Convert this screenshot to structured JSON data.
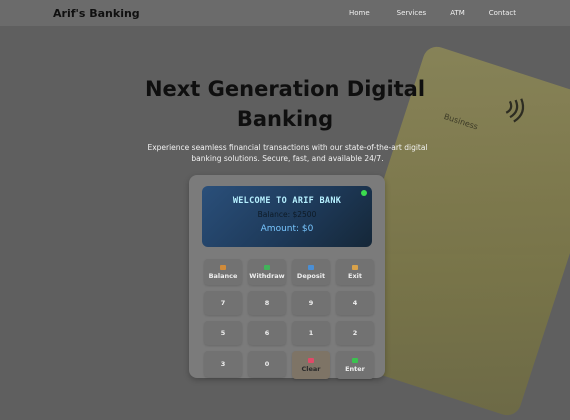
{
  "nav": {
    "brand": "Arif's Banking",
    "links": [
      "Home",
      "Services",
      "ATM",
      "Contact"
    ]
  },
  "hero": {
    "title_line1": "Next Generation Digital",
    "title_line2": "Banking",
    "subtitle_line1": "Experience seamless financial transactions with our state-of-the-art digital",
    "subtitle_line2": "banking solutions. Secure, fast, and available 24/7."
  },
  "bg_card": {
    "label": "Business"
  },
  "atm": {
    "screen": {
      "welcome": "WELCOME TO ARIF BANK",
      "balance": "Balance: $2500",
      "amount": "Amount: $0"
    },
    "actions": [
      "Balance",
      "Withdraw",
      "Deposit",
      "Exit"
    ],
    "row1": [
      "7",
      "8",
      "9",
      "4"
    ],
    "row2": [
      "5",
      "6",
      "1",
      "2"
    ],
    "row3": [
      "3",
      "0",
      "Clear",
      "Enter"
    ]
  },
  "colors": {
    "led": "#3bdc4f",
    "screen_bg": "#1e3a5a",
    "welcome_text": "#b6f0ff",
    "amount_text": "#78c6ff"
  }
}
